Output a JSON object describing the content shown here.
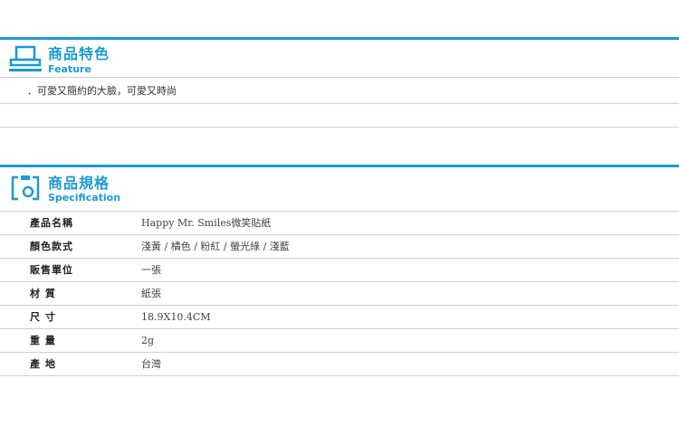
{
  "theme": {
    "accent": "#1a9ad6",
    "divider": "#cfcfcf"
  },
  "feature": {
    "title_zh": "商品特色",
    "title_en": "Feature",
    "icon": "printer-icon",
    "text": "．可愛又簡約的大臉，可愛又時尚"
  },
  "spec": {
    "title_zh": "商品規格",
    "title_en": "Specification",
    "icon": "camera-frame-icon",
    "rows": [
      {
        "label": "產品名稱",
        "value": "Happy Mr. Smiles微笑貼紙"
      },
      {
        "label": "顏色款式",
        "value": "淺黃 / 橘色 / 粉紅 / 螢光綠 / 淺藍"
      },
      {
        "label": "販售單位",
        "value": "一張"
      },
      {
        "label": "材 質",
        "value": "紙張"
      },
      {
        "label": "尺 寸",
        "value": "18.9X10.4CM"
      },
      {
        "label": "重 量",
        "value": "2g"
      },
      {
        "label": "產 地",
        "value": "台灣"
      }
    ]
  }
}
